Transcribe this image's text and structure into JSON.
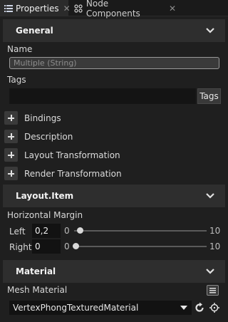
{
  "tabs": [
    {
      "label": "Properties",
      "icon": "list-icon",
      "close": "✕"
    },
    {
      "label": "Node Components",
      "icon": "components-icon",
      "close": "✕"
    }
  ],
  "general": {
    "title": "General",
    "name_label": "Name",
    "name_placeholder": "Multiple (String)",
    "tags_label": "Tags",
    "tags_button": "Tags",
    "expanders": [
      "Bindings",
      "Description",
      "Layout Transformation",
      "Render Transformation"
    ]
  },
  "layout_item": {
    "title": "Layout.Item",
    "margin_label": "Horizontal Margin",
    "left": {
      "label": "Left",
      "value": "0,2",
      "min": "0",
      "max": "10",
      "fraction": 0.02
    },
    "right": {
      "label": "Right",
      "value": "0",
      "min": "0",
      "max": "10",
      "fraction": 0.0
    }
  },
  "material": {
    "title": "Material",
    "mesh_label": "Mesh Material",
    "selected": "VertexPhongTexturedMaterial"
  }
}
